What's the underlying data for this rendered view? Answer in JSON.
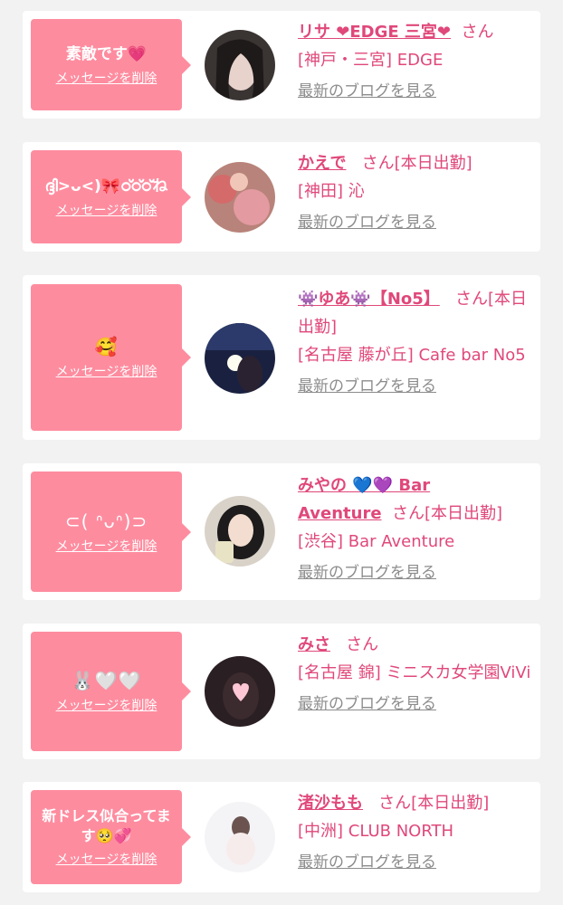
{
  "delete_label": "メッセージを削除",
  "blog_label": "最新のブログを見る",
  "san": "さん",
  "cards": [
    {
      "message": "素敵です💗",
      "name": "リサ ❤EDGE 三宮❤",
      "suffix": "",
      "shop": "[神戸・三宮] EDGE",
      "avatar": "avatar-lisa"
    },
    {
      "message": "ദ്ദി>ᴗ<)🎀ഠ്ഠ്ഠ്ね",
      "name": "かえで",
      "suffix": "[本日出勤]",
      "shop": "[神田] 沁",
      "avatar": "avatar-kaede"
    },
    {
      "message": "🥰",
      "name": "👾ゆあ👾【No5】",
      "suffix": "[本日出勤]",
      "shop": "[名古屋 藤が丘] Cafe bar No5",
      "avatar": "avatar-yua"
    },
    {
      "message": "⊂( ᐢᴗᐢ)⊃",
      "name": "みやの 💙💜 Bar Aventure",
      "suffix": "[本日出勤]",
      "shop": "[渋谷] Bar Aventure",
      "avatar": "avatar-miyano"
    },
    {
      "message": "🐰🤍🤍",
      "name": "みさ",
      "suffix": "",
      "shop": "[名古屋 錦] ミニスカ女学園ViVi",
      "avatar": "avatar-misa"
    },
    {
      "message": "新ドレス似合ってます🥺💞",
      "name": "渚沙もも",
      "suffix": "[本日出勤]",
      "shop": "[中洲] CLUB NORTH",
      "avatar": "avatar-nagisa"
    }
  ]
}
